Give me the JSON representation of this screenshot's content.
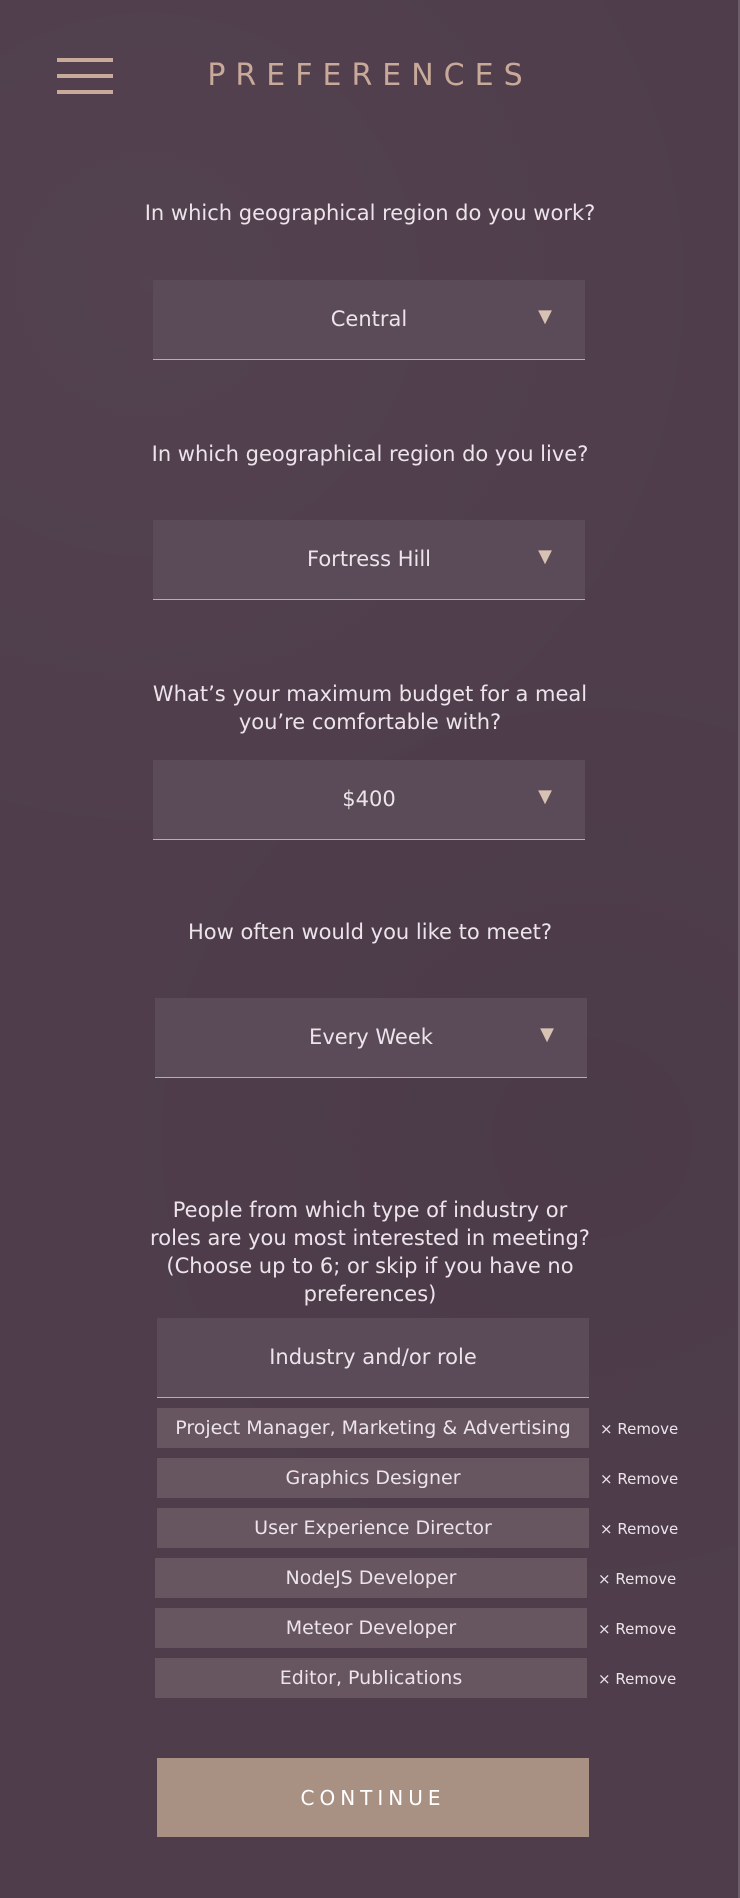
{
  "header": {
    "title": "PREFERENCES",
    "menu_icon": "hamburger-menu-icon"
  },
  "questions": {
    "work_region": {
      "label": "In which geographical region do you work?",
      "value": "Central"
    },
    "live_region": {
      "label": "In which geographical region do you live?",
      "value": "Fortress Hill"
    },
    "budget": {
      "label": "What’s your maximum budget for a meal you’re comfortable with?",
      "value": "$400"
    },
    "frequency": {
      "label": "How often would you like to meet?",
      "value": "Every Week"
    },
    "industry": {
      "label": "People from which type of industry or roles are you most interested in meeting? (Choose up to 6; or skip if you have no preferences)",
      "placeholder": "Industry and/or role"
    }
  },
  "dropdown_arrow": "▼",
  "selected_roles": [
    {
      "label": "Project Manager, Marketing & Advertising",
      "remove": "× Remove"
    },
    {
      "label": "Graphics Designer",
      "remove": "× Remove"
    },
    {
      "label": "User Experience Director",
      "remove": "× Remove"
    },
    {
      "label": "NodeJS Developer",
      "remove": "× Remove"
    },
    {
      "label": "Meteor Developer",
      "remove": "× Remove"
    },
    {
      "label": "Editor, Publications",
      "remove": "× Remove"
    }
  ],
  "continue_button": "CONTINUE",
  "colors": {
    "background": "#4f3d4b",
    "accent": "#c9a99a",
    "field": "#5b4a58",
    "tag": "#67555f",
    "button": "#a89083"
  }
}
